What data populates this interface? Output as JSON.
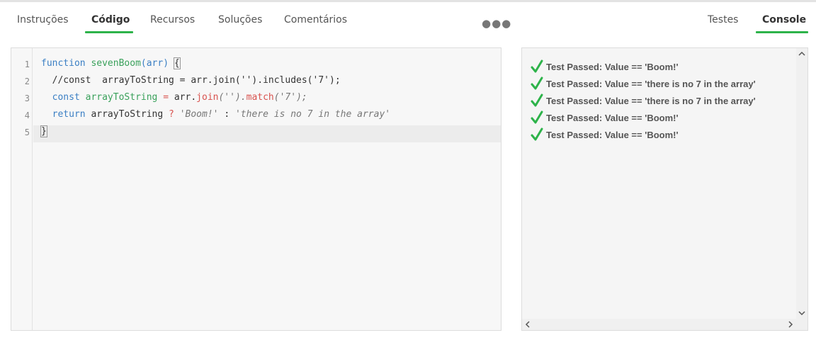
{
  "tabs_left": [
    {
      "label": "Instruções",
      "active": false
    },
    {
      "label": "Código",
      "active": true
    },
    {
      "label": "Recursos",
      "active": false
    },
    {
      "label": "Soluções",
      "active": false
    },
    {
      "label": "Comentários",
      "active": false
    }
  ],
  "more_label": "●●●",
  "tabs_right": [
    {
      "label": "Testes",
      "active": false
    },
    {
      "label": "Console",
      "active": true
    }
  ],
  "editor": {
    "line_numbers": [
      "1",
      "2",
      "3",
      "4",
      "5"
    ],
    "line1": {
      "kw": "function",
      "name": "sevenBoom",
      "open": "(",
      "param": "arr",
      "close": ")",
      "brace": "{"
    },
    "line2": {
      "text": "//const  arrayToString = arr.join('').includes('7');"
    },
    "line3": {
      "kw": "const",
      "var": "arrayToString",
      "eq": "=",
      "obj": "arr.",
      "m1": "join",
      "a1": "('').",
      "m2": "match",
      "a2": "('7');"
    },
    "line4": {
      "kw": "return",
      "var": "arrayToString",
      "q": "?",
      "s1": "'Boom!'",
      "colon": ":",
      "s2": "'there is no 7 in the array'"
    },
    "line5": {
      "brace": "}"
    }
  },
  "console": {
    "check_color": "#2db34a",
    "results": [
      "Test Passed: Value == 'Boom!'",
      "Test Passed: Value == 'there is no 7 in the array'",
      "Test Passed: Value == 'there is no 7 in the array'",
      "Test Passed: Value == 'Boom!'",
      "Test Passed: Value == 'Boom!'"
    ],
    "scroll_up": "^",
    "scroll_down": "v",
    "scroll_left": "<",
    "scroll_right": ">"
  },
  "accent_color": "#2db34a"
}
